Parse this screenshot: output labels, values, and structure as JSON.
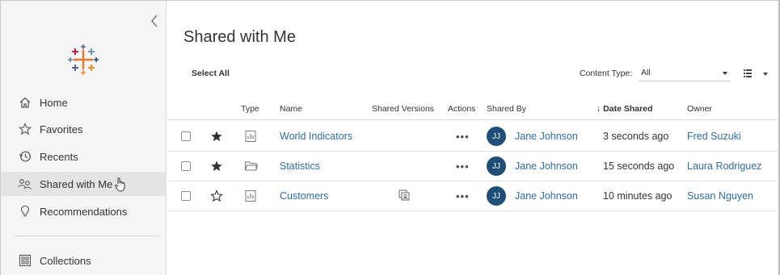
{
  "sidebar": {
    "items": [
      {
        "id": "home",
        "label": "Home",
        "icon": "home-icon",
        "active": false
      },
      {
        "id": "favorites",
        "label": "Favorites",
        "icon": "star-icon",
        "active": false
      },
      {
        "id": "recents",
        "label": "Recents",
        "icon": "clock-icon",
        "active": false
      },
      {
        "id": "shared",
        "label": "Shared with Me",
        "icon": "shared-users-icon",
        "active": true
      },
      {
        "id": "recommendations",
        "label": "Recommendations",
        "icon": "lightbulb-icon",
        "active": false
      },
      {
        "id": "collections",
        "label": "Collections",
        "icon": "collections-icon",
        "active": false
      }
    ]
  },
  "main": {
    "title": "Shared with Me",
    "select_all": "Select All",
    "content_type_label": "Content Type:",
    "content_type_value": "All"
  },
  "table": {
    "headers": {
      "type": "Type",
      "name": "Name",
      "shared_versions": "Shared Versions",
      "actions": "Actions",
      "shared_by": "Shared By",
      "date_shared": "↓ Date Shared",
      "owner": "Owner"
    },
    "rows": [
      {
        "favorite": true,
        "type_icon": "workbook-icon",
        "name": "World Indicators",
        "shared_versions": "",
        "actions": "•••",
        "initials": "JJ",
        "shared_by": "Jane Johnson",
        "date_shared": "3 seconds ago",
        "owner": "Fred Suzuki"
      },
      {
        "favorite": true,
        "type_icon": "folder-icon",
        "name": "Statistics",
        "shared_versions": "",
        "actions": "•••",
        "initials": "JJ",
        "shared_by": "Jane Johnson",
        "date_shared": "15 seconds ago",
        "owner": "Laura Rodriguez"
      },
      {
        "favorite": false,
        "type_icon": "workbook-icon",
        "name": "Customers",
        "shared_versions": "customized-views-icon",
        "actions": "•••",
        "initials": "JJ",
        "shared_by": "Jane Johnson",
        "date_shared": "10 minutes ago",
        "owner": "Susan Nguyen"
      }
    ]
  },
  "colors": {
    "link": "#2c6bb0",
    "avatar": "#1f4e79",
    "sidebar_bg": "#f5f5f5",
    "active_bg": "#e4e4e4"
  }
}
